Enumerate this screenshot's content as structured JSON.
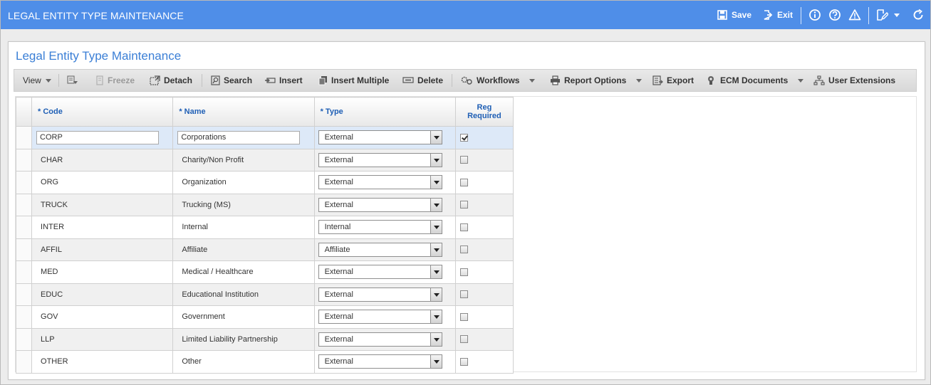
{
  "header": {
    "title": "LEGAL ENTITY TYPE MAINTENANCE",
    "save_label": "Save",
    "exit_label": "Exit"
  },
  "panel": {
    "title": "Legal Entity Type Maintenance"
  },
  "toolbar": {
    "view": "View",
    "freeze": "Freeze",
    "detach": "Detach",
    "search": "Search",
    "insert": "Insert",
    "insert_multiple": "Insert Multiple",
    "delete": "Delete",
    "workflows": "Workflows",
    "report_options": "Report Options",
    "export": "Export",
    "ecm_documents": "ECM Documents",
    "user_extensions": "User Extensions"
  },
  "grid": {
    "columns": {
      "code": "* Code",
      "name": "* Name",
      "type": "* Type",
      "reg_line1": "Reg",
      "reg_line2": "Required"
    },
    "rows": [
      {
        "code": "CORP",
        "name": "Corporations",
        "type": "External",
        "reg_required": true
      },
      {
        "code": "CHAR",
        "name": "Charity/Non Profit",
        "type": "External",
        "reg_required": false
      },
      {
        "code": "ORG",
        "name": "Organization",
        "type": "External",
        "reg_required": false
      },
      {
        "code": "TRUCK",
        "name": "Trucking (MS)",
        "type": "External",
        "reg_required": false
      },
      {
        "code": "INTER",
        "name": "Internal",
        "type": "Internal",
        "reg_required": false
      },
      {
        "code": "AFFIL",
        "name": "Affiliate",
        "type": "Affiliate",
        "reg_required": false
      },
      {
        "code": "MED",
        "name": "Medical / Healthcare",
        "type": "External",
        "reg_required": false
      },
      {
        "code": "EDUC",
        "name": "Educational Institution",
        "type": "External",
        "reg_required": false
      },
      {
        "code": "GOV",
        "name": "Government",
        "type": "External",
        "reg_required": false
      },
      {
        "code": "LLP",
        "name": "Limited Liability Partnership",
        "type": "External",
        "reg_required": false
      },
      {
        "code": "OTHER",
        "name": "Other",
        "type": "External",
        "reg_required": false
      }
    ]
  },
  "colors": {
    "header_bg": "#4f8ee8",
    "title_blue": "#3b7fd6",
    "selected_row": "#dde9f8"
  }
}
